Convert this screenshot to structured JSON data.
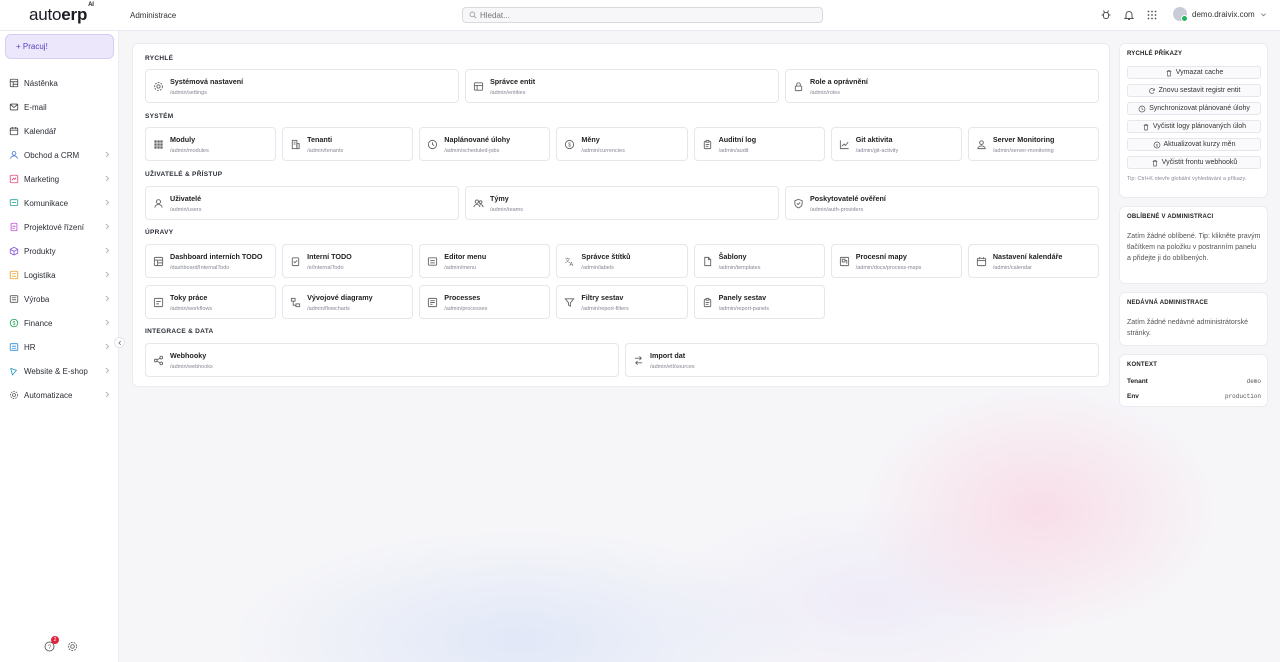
{
  "header": {
    "logo_main": "auto",
    "logo_bold": "erp",
    "logo_sup": "AI",
    "breadcrumb": "Administrace",
    "search_placeholder": "Hledat...",
    "user_email": "demo.draivix.com",
    "icons": [
      "bug-icon",
      "bell-icon",
      "grid-icon"
    ]
  },
  "sidebar": {
    "work_button": "+ Pracuj!",
    "items": [
      {
        "label": "Nástěnka",
        "icon": "dashboard-icon",
        "color": "#444",
        "arrow": false
      },
      {
        "label": "E-mail",
        "icon": "mail-icon",
        "color": "#444",
        "arrow": false
      },
      {
        "label": "Kalendář",
        "icon": "calendar-icon",
        "color": "#444",
        "arrow": false
      },
      {
        "label": "Obchod a CRM",
        "icon": "user-icon",
        "color": "#4a78d8",
        "arrow": true
      },
      {
        "label": "Marketing",
        "icon": "marketing-icon",
        "color": "#e04a7a",
        "arrow": true
      },
      {
        "label": "Komunikace",
        "icon": "chat-icon",
        "color": "#2aa39a",
        "arrow": true
      },
      {
        "label": "Projektové řízení",
        "icon": "project-icon",
        "color": "#c04ad8",
        "arrow": true
      },
      {
        "label": "Produkty",
        "icon": "box-icon",
        "color": "#8a5ad8",
        "arrow": true
      },
      {
        "label": "Logistika",
        "icon": "truck-icon",
        "color": "#e8a020",
        "arrow": true
      },
      {
        "label": "Výroba",
        "icon": "factory-icon",
        "color": "#555",
        "arrow": true
      },
      {
        "label": "Finance",
        "icon": "coin-icon",
        "color": "#22a05a",
        "arrow": true
      },
      {
        "label": "HR",
        "icon": "people-icon",
        "color": "#2a8ad8",
        "arrow": true
      },
      {
        "label": "Website & E-shop",
        "icon": "globe-icon",
        "color": "#2a9ac8",
        "arrow": true
      },
      {
        "label": "Automatizace",
        "icon": "gear-icon",
        "color": "#666",
        "arrow": true
      }
    ],
    "help_badge": "2"
  },
  "sections": [
    {
      "title": "RYCHLÉ",
      "tiles": [
        {
          "title": "Systémová nastavení",
          "path": "/admin/settings",
          "icon": "gear-icon"
        },
        {
          "title": "Správce entit",
          "path": "/admin/entities",
          "icon": "entity-icon"
        },
        {
          "title": "Role a oprávnění",
          "path": "/admin/roles",
          "icon": "lock-icon"
        }
      ]
    },
    {
      "title": "SYSTÉM",
      "tiles": [
        {
          "title": "Moduly",
          "path": "/admin/modules",
          "icon": "grid-icon"
        },
        {
          "title": "Tenanti",
          "path": "/admin/tenants",
          "icon": "building-icon"
        },
        {
          "title": "Naplánované úlohy",
          "path": "/admin/scheduled-jobs",
          "icon": "clock-icon"
        },
        {
          "title": "Měny",
          "path": "/admin/currencies",
          "icon": "currency-icon"
        },
        {
          "title": "Auditní log",
          "path": "/admin/audit",
          "icon": "clipboard-icon"
        },
        {
          "title": "Git aktivita",
          "path": "/admin/git-activity",
          "icon": "chart-line-icon"
        },
        {
          "title": "Server Monitoring",
          "path": "/admin/server-monitoring",
          "icon": "user-monitor-icon"
        }
      ]
    },
    {
      "title": "UŽIVATELÉ & PŘÍSTUP",
      "tiles": [
        {
          "title": "Uživatelé",
          "path": "/admin/users",
          "icon": "user-icon"
        },
        {
          "title": "Týmy",
          "path": "/admin/teams",
          "icon": "team-icon"
        },
        {
          "title": "Poskytovatelé ověření",
          "path": "/admin/auth-providers",
          "icon": "shield-icon"
        }
      ]
    },
    {
      "title": "ÚPRAVY",
      "tiles": [
        {
          "title": "Dashboard interních TODO",
          "path": "/dashboard/InternalTodo",
          "icon": "dashboard-icon"
        },
        {
          "title": "Interní TODO",
          "path": "/e/InternalTodo",
          "icon": "checklist-icon"
        },
        {
          "title": "Editor menu",
          "path": "/admin/menu",
          "icon": "list-icon"
        },
        {
          "title": "Správce štítků",
          "path": "/admin/labels",
          "icon": "translate-icon"
        },
        {
          "title": "Šablony",
          "path": "/admin/templates",
          "icon": "file-icon"
        },
        {
          "title": "Procesní mapy",
          "path": "/admin/docs/process-maps",
          "icon": "map-icon"
        },
        {
          "title": "Nastavení kalendáře",
          "path": "/admin/calendar",
          "icon": "calendar-icon"
        },
        {
          "title": "Toky práce",
          "path": "/admin/workflows",
          "icon": "workflow-icon"
        },
        {
          "title": "Vývojové diagramy",
          "path": "/admin/flowcharts",
          "icon": "flowchart-icon"
        },
        {
          "title": "Processes",
          "path": "/admin/processes",
          "icon": "process-icon"
        },
        {
          "title": "Filtry sestav",
          "path": "/admin/report-filters",
          "icon": "filter-icon"
        },
        {
          "title": "Panely sestav",
          "path": "/admin/report-panels",
          "icon": "clipboard-icon"
        }
      ]
    },
    {
      "title": "INTEGRACE & DATA",
      "tiles": [
        {
          "title": "Webhooky",
          "path": "/admin/webhooks",
          "icon": "share-icon"
        },
        {
          "title": "Import dat",
          "path": "/admin/etl/sources",
          "icon": "import-icon"
        }
      ]
    }
  ],
  "quick_commands": {
    "title": "RYCHLÉ PŘÍKAZY",
    "buttons": [
      {
        "label": "Vymazat cache",
        "icon": "trash-icon"
      },
      {
        "label": "Znovu sestavit registr entit",
        "icon": "refresh-icon"
      },
      {
        "label": "Synchronizovat plánované úlohy",
        "icon": "clock-icon"
      },
      {
        "label": "Vyčistit logy plánovaných úloh",
        "icon": "trash-icon"
      },
      {
        "label": "Aktualizovat kurzy měn",
        "icon": "currency-icon"
      },
      {
        "label": "Vyčistit frontu webhooků",
        "icon": "trash-icon"
      }
    ],
    "tip": "Tip: Ctrl+K otevře globální vyhledávání a příkazy."
  },
  "favorites": {
    "title": "OBLÍBENÉ V ADMINISTRACI",
    "text": "Zatím žádné oblíbené. Tip: klikněte pravým tlačítkem na položku v postranním panelu a přidejte ji do oblíbených."
  },
  "recent": {
    "title": "NEDÁVNÁ ADMINISTRACE",
    "text": "Zatím žádné nedávné administrátorské stránky."
  },
  "context": {
    "title": "KONTEXT",
    "rows": [
      {
        "key": "Tenant",
        "value": "demo"
      },
      {
        "key": "Env",
        "value": "production"
      }
    ]
  }
}
